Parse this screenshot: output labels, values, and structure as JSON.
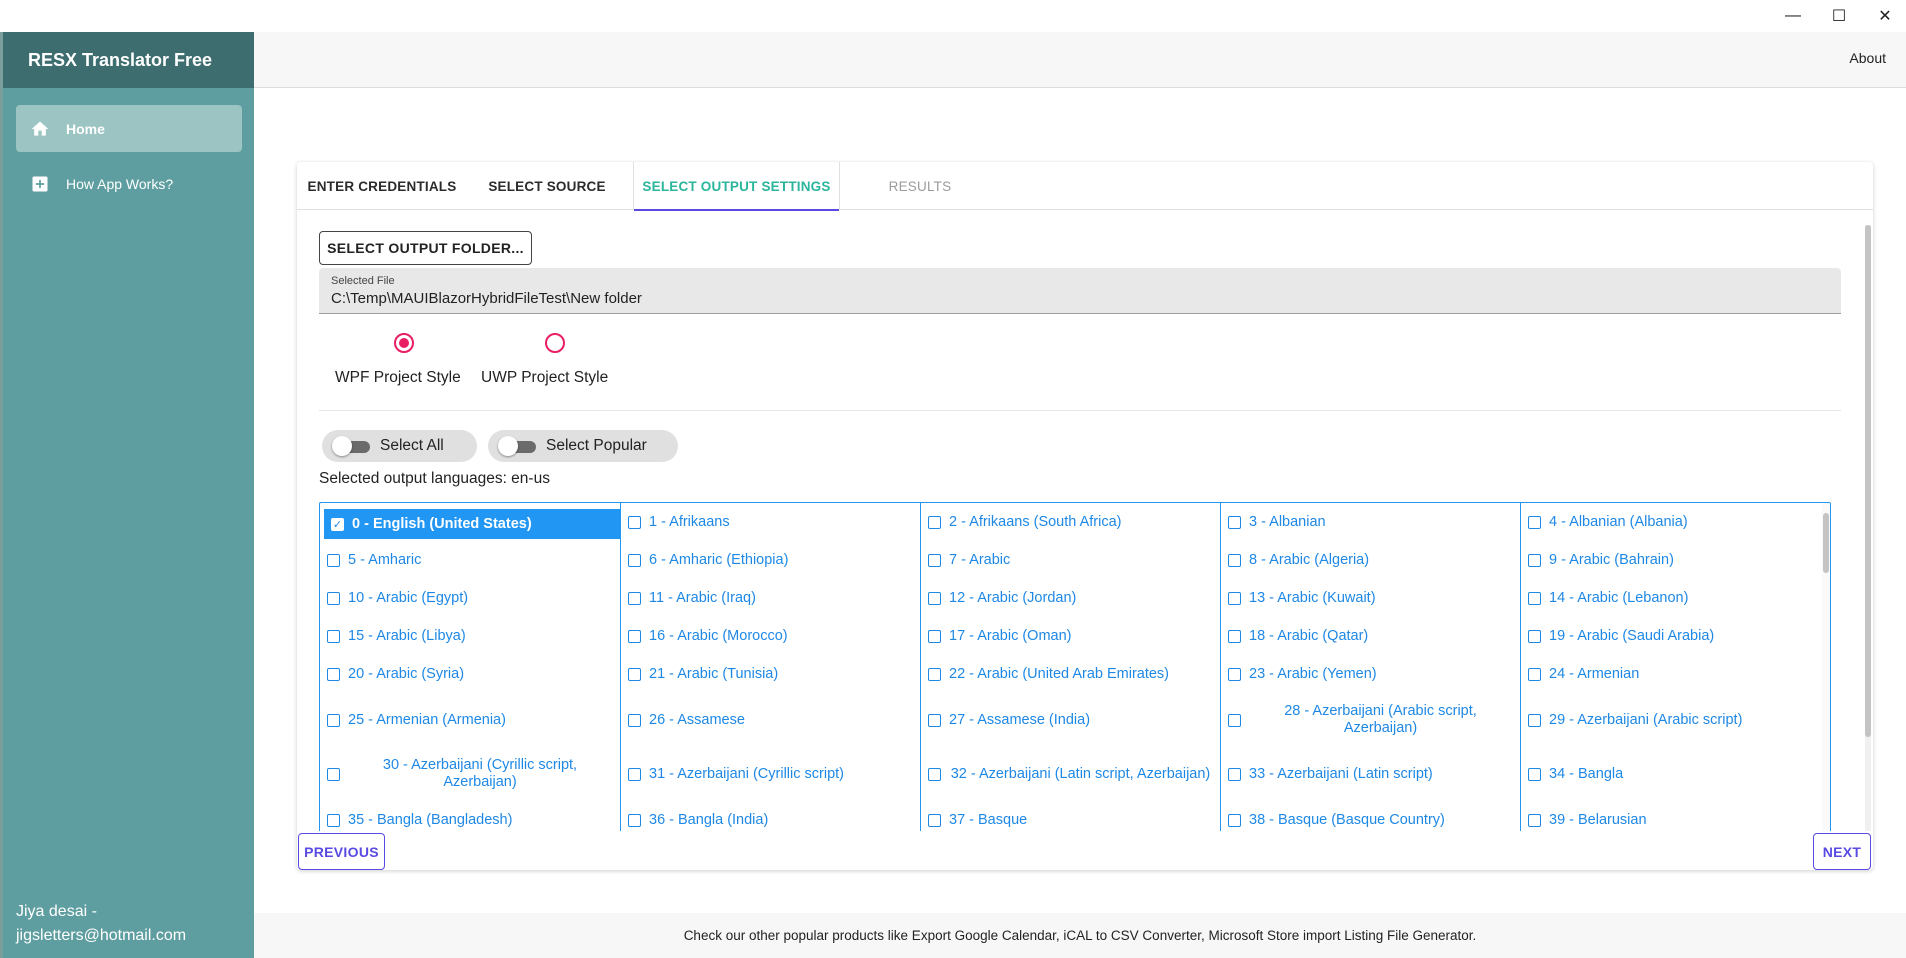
{
  "window": {
    "minimize_glyph": "—",
    "maximize_glyph": "☐",
    "close_glyph": "✕"
  },
  "sidebar": {
    "brand": "RESX Translator Free",
    "items": [
      {
        "label": "Home",
        "icon": "home-icon",
        "active": true
      },
      {
        "label": "How App Works?",
        "icon": "plus-box-icon",
        "active": false
      }
    ],
    "user": "Jiya desai - jigsletters@hotmail.com"
  },
  "header": {
    "about": "About"
  },
  "tabs": [
    {
      "label": "ENTER CREDENTIALS"
    },
    {
      "label": "SELECT SOURCE"
    },
    {
      "label": "SELECT OUTPUT SETTINGS"
    },
    {
      "label": "RESULTS"
    }
  ],
  "output": {
    "select_folder_label": "SELECT OUTPUT FOLDER...",
    "field_label": "Selected File",
    "field_value": "C:\\Temp\\MAUIBlazorHybridFileTest\\New folder"
  },
  "project_style": {
    "options": [
      {
        "label": "WPF Project Style",
        "checked": true
      },
      {
        "label": "UWP Project Style",
        "checked": false
      }
    ]
  },
  "switches": {
    "select_all": "Select All",
    "select_popular": "Select Popular"
  },
  "selected_output": "Selected output languages: en-us",
  "languages": [
    "0 - English (United States)",
    "1 - Afrikaans",
    "2 - Afrikaans (South Africa)",
    "3 - Albanian",
    "4 - Albanian (Albania)",
    "5 - Amharic",
    "6 - Amharic (Ethiopia)",
    "7 - Arabic",
    "8 - Arabic (Algeria)",
    "9 - Arabic (Bahrain)",
    "10 - Arabic (Egypt)",
    "11 - Arabic (Iraq)",
    "12 - Arabic (Jordan)",
    "13 - Arabic (Kuwait)",
    "14 - Arabic (Lebanon)",
    "15 - Arabic (Libya)",
    "16 - Arabic (Morocco)",
    "17 - Arabic (Oman)",
    "18 - Arabic (Qatar)",
    "19 - Arabic (Saudi Arabia)",
    "20 - Arabic (Syria)",
    "21 - Arabic (Tunisia)",
    "22 - Arabic (United Arab Emirates)",
    "23 - Arabic (Yemen)",
    "24 - Armenian",
    "25 - Armenian (Armenia)",
    "26 - Assamese",
    "27 - Assamese (India)",
    "28 - Azerbaijani (Arabic script, Azerbaijan)",
    "29 - Azerbaijani (Arabic script)",
    "30 - Azerbaijani (Cyrillic script, Azerbaijan)",
    "31 - Azerbaijani (Cyrillic script)",
    "32 - Azerbaijani (Latin script, Azerbaijan)",
    "33 - Azerbaijani (Latin script)",
    "34 - Bangla",
    "35 - Bangla (Bangladesh)",
    "36 - Bangla (India)",
    "37 - Basque",
    "38 - Basque (Basque Country)",
    "39 - Belarusian"
  ],
  "selected_language_index": 0,
  "nav": {
    "previous": "PREVIOUS",
    "next": "NEXT"
  },
  "footer": "Check our other popular products like Export Google Calendar, iCAL to CSV Converter, Microsoft Store import Listing File Generator."
}
